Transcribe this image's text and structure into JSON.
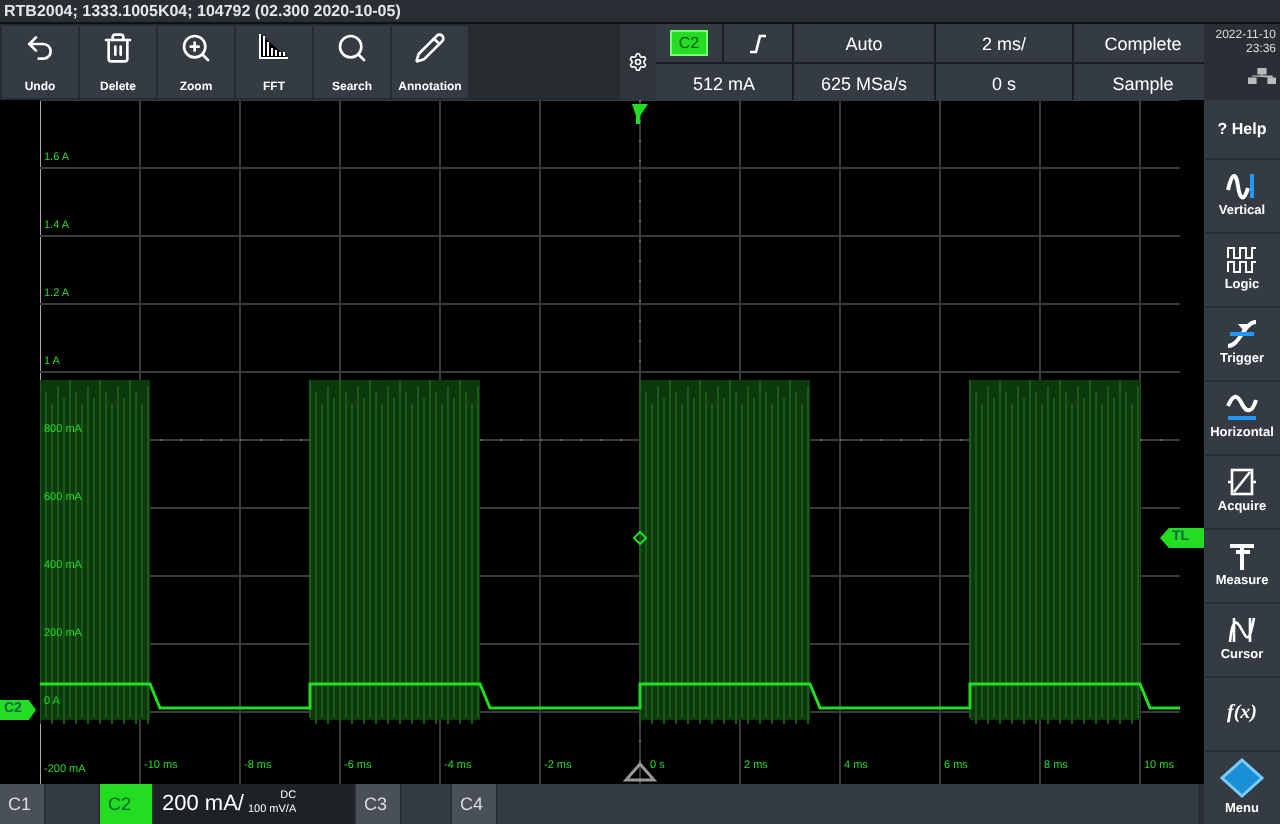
{
  "title": "RTB2004; 1333.1005K04; 104792 (02.300 2020-10-05)",
  "toolbar": [
    {
      "label": "Undo"
    },
    {
      "label": "Delete"
    },
    {
      "label": "Zoom"
    },
    {
      "label": "FFT"
    },
    {
      "label": "Search"
    },
    {
      "label": "Annotation"
    }
  ],
  "trigger": {
    "channel": "C2",
    "level": "512 mA",
    "mode": "Auto",
    "sample_rate": "625 MSa/s",
    "timebase": "2 ms/",
    "position": "0 s",
    "acquisition": "Complete",
    "acq_mode": "Sample"
  },
  "clock": {
    "date": "2022-11-10",
    "time": "23:36"
  },
  "plot": {
    "y_labels": [
      "1.6 A",
      "1.4 A",
      "1.2 A",
      "1 A",
      "800 mA",
      "600 mA",
      "400 mA",
      "200 mA",
      "0 A",
      "-200 mA"
    ],
    "x_labels": [
      "-10 ms",
      "-8 ms",
      "-6 ms",
      "-4 ms",
      "-2 ms",
      "0 s",
      "2 ms",
      "4 ms",
      "6 ms",
      "8 ms",
      "10 ms"
    ],
    "channel_marker": "C2",
    "trigger_level_marker": "TL"
  },
  "sidebar": [
    {
      "label": "Help",
      "glyph": "?"
    },
    {
      "label": "Vertical"
    },
    {
      "label": "Logic"
    },
    {
      "label": "Trigger"
    },
    {
      "label": "Horizontal"
    },
    {
      "label": "Acquire"
    },
    {
      "label": "Measure"
    },
    {
      "label": "Cursor"
    },
    {
      "label": "f(x)"
    },
    {
      "label": "Menu"
    }
  ],
  "channels": [
    {
      "label": "C1",
      "selected": false
    },
    {
      "label": "C2",
      "selected": true,
      "scale": "200 mA/",
      "coupling": "DC",
      "probe": "100 mV/A"
    },
    {
      "label": "C3",
      "selected": false
    },
    {
      "label": "C4",
      "selected": false
    }
  ]
}
